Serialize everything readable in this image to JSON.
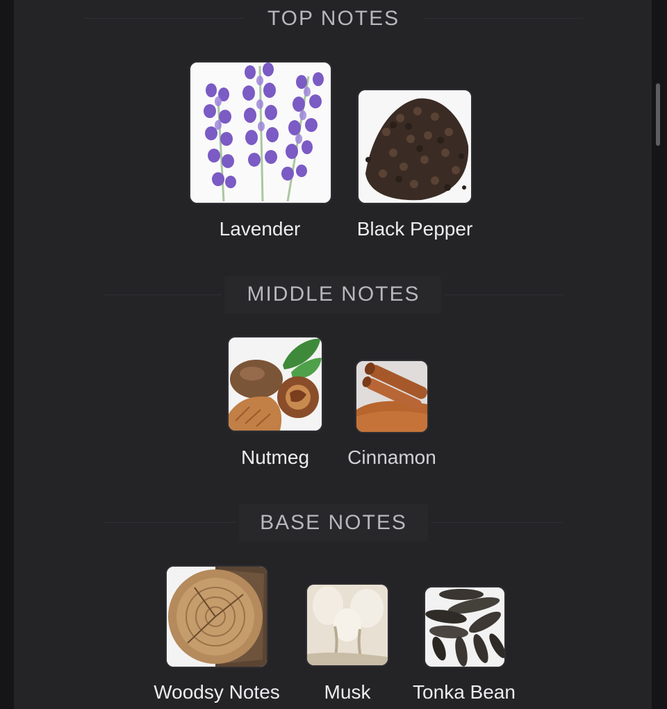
{
  "sections": {
    "top": {
      "title": "TOP NOTES",
      "notes": [
        {
          "label": "Lavender",
          "icon": "lavender-icon"
        },
        {
          "label": "Black Pepper",
          "icon": "black-pepper-icon"
        }
      ]
    },
    "middle": {
      "title": "MIDDLE NOTES",
      "notes": [
        {
          "label": "Nutmeg",
          "icon": "nutmeg-icon"
        },
        {
          "label": "Cinnamon",
          "icon": "cinnamon-icon"
        }
      ]
    },
    "base": {
      "title": "BASE NOTES",
      "notes": [
        {
          "label": "Woodsy Notes",
          "icon": "wood-log-icon"
        },
        {
          "label": "Musk",
          "icon": "musk-icon"
        },
        {
          "label": "Tonka Bean",
          "icon": "tonka-bean-icon"
        }
      ]
    }
  },
  "colors": {
    "background": "#242427",
    "title": "#b7b7bd",
    "label": "#ececef"
  }
}
